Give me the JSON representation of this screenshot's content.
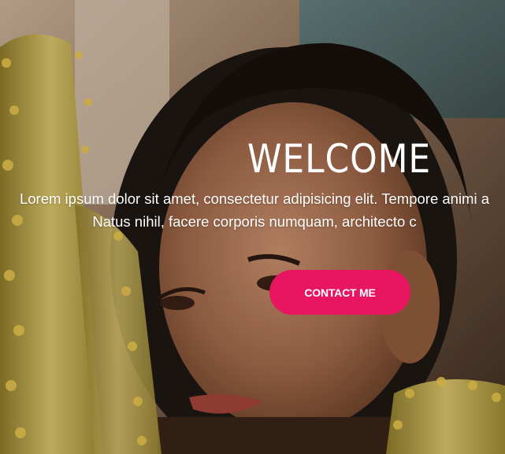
{
  "hero": {
    "title": "WELCOME",
    "lead_line_1": "Lorem ipsum dolor sit amet, consectetur adipisicing elit. Tempore animi a",
    "lead_line_2": "Natus nihil, facere corporis numquam, architecto c",
    "cta_label": "CONTACT ME"
  },
  "colors": {
    "accent": "#e81561",
    "text": "#ffffff"
  }
}
